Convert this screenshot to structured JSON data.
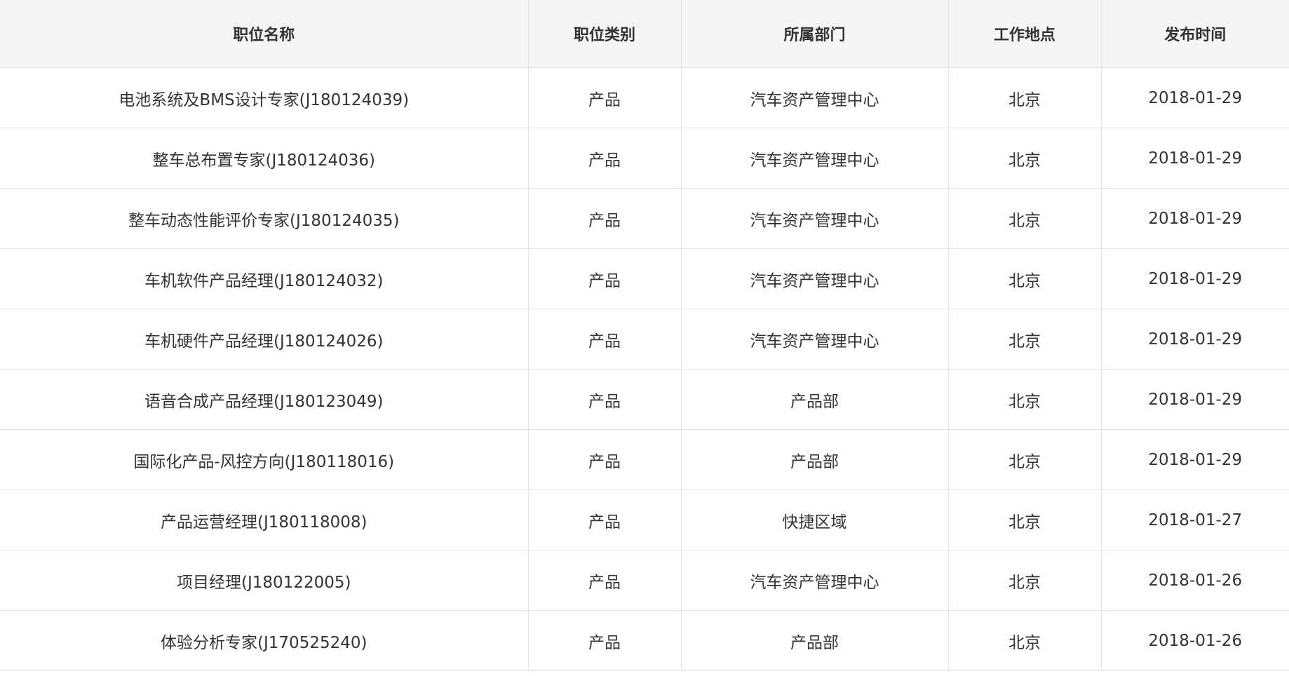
{
  "table": {
    "headers": [
      "职位名称",
      "职位类别",
      "所属部门",
      "工作地点",
      "发布时间"
    ],
    "rows": [
      [
        "电池系统及BMS设计专家(J180124039)",
        "产品",
        "汽车资产管理中心",
        "北京",
        "2018-01-29"
      ],
      [
        "整车总布置专家(J180124036)",
        "产品",
        "汽车资产管理中心",
        "北京",
        "2018-01-29"
      ],
      [
        "整车动态性能评价专家(J180124035)",
        "产品",
        "汽车资产管理中心",
        "北京",
        "2018-01-29"
      ],
      [
        "车机软件产品经理(J180124032)",
        "产品",
        "汽车资产管理中心",
        "北京",
        "2018-01-29"
      ],
      [
        "车机硬件产品经理(J180124026)",
        "产品",
        "汽车资产管理中心",
        "北京",
        "2018-01-29"
      ],
      [
        "语音合成产品经理(J180123049)",
        "产品",
        "产品部",
        "北京",
        "2018-01-29"
      ],
      [
        "国际化产品-风控方向(J180118016)",
        "产品",
        "产品部",
        "北京",
        "2018-01-29"
      ],
      [
        "产品运营经理(J180118008)",
        "产品",
        "快捷区域",
        "北京",
        "2018-01-27"
      ],
      [
        "项目经理(J180122005)",
        "产品",
        "汽车资产管理中心",
        "北京",
        "2018-01-26"
      ],
      [
        "体验分析专家(J170525240)",
        "产品",
        "产品部",
        "北京",
        "2018-01-26"
      ]
    ]
  }
}
